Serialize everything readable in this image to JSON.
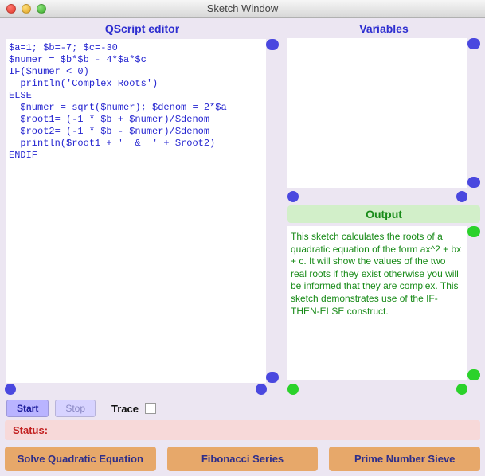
{
  "window": {
    "title": "Sketch Window"
  },
  "panels": {
    "editor_title": "QScript editor",
    "variables_title": "Variables",
    "output_title": "Output"
  },
  "editor_code": "$a=1; $b=-7; $c=-30\n$numer = $b*$b - 4*$a*$c\nIF($numer < 0)\n  println('Complex Roots')\nELSE\n  $numer = sqrt($numer); $denom = 2*$a\n  $root1= (-1 * $b + $numer)/$denom\n  $root2= (-1 * $b - $numer)/$denom\n  println($root1 + '  &  ' + $root2)\nENDIF",
  "variables_text": "",
  "output_text": "This sketch calculates the roots of a quadratic equation of the form ax^2 + bx + c. It will show the values of the two real roots if they exist otherwise you will  be informed that they are complex. This sketch demonstrates use of the IF-THEN-ELSE construct.",
  "controls": {
    "start": "Start",
    "stop": "Stop",
    "trace": "Trace"
  },
  "status": {
    "label": "Status:",
    "value": ""
  },
  "buttons": {
    "solve": "Solve Quadratic Equation",
    "fib": "Fibonacci Series",
    "sieve": "Prime Number Sieve"
  }
}
